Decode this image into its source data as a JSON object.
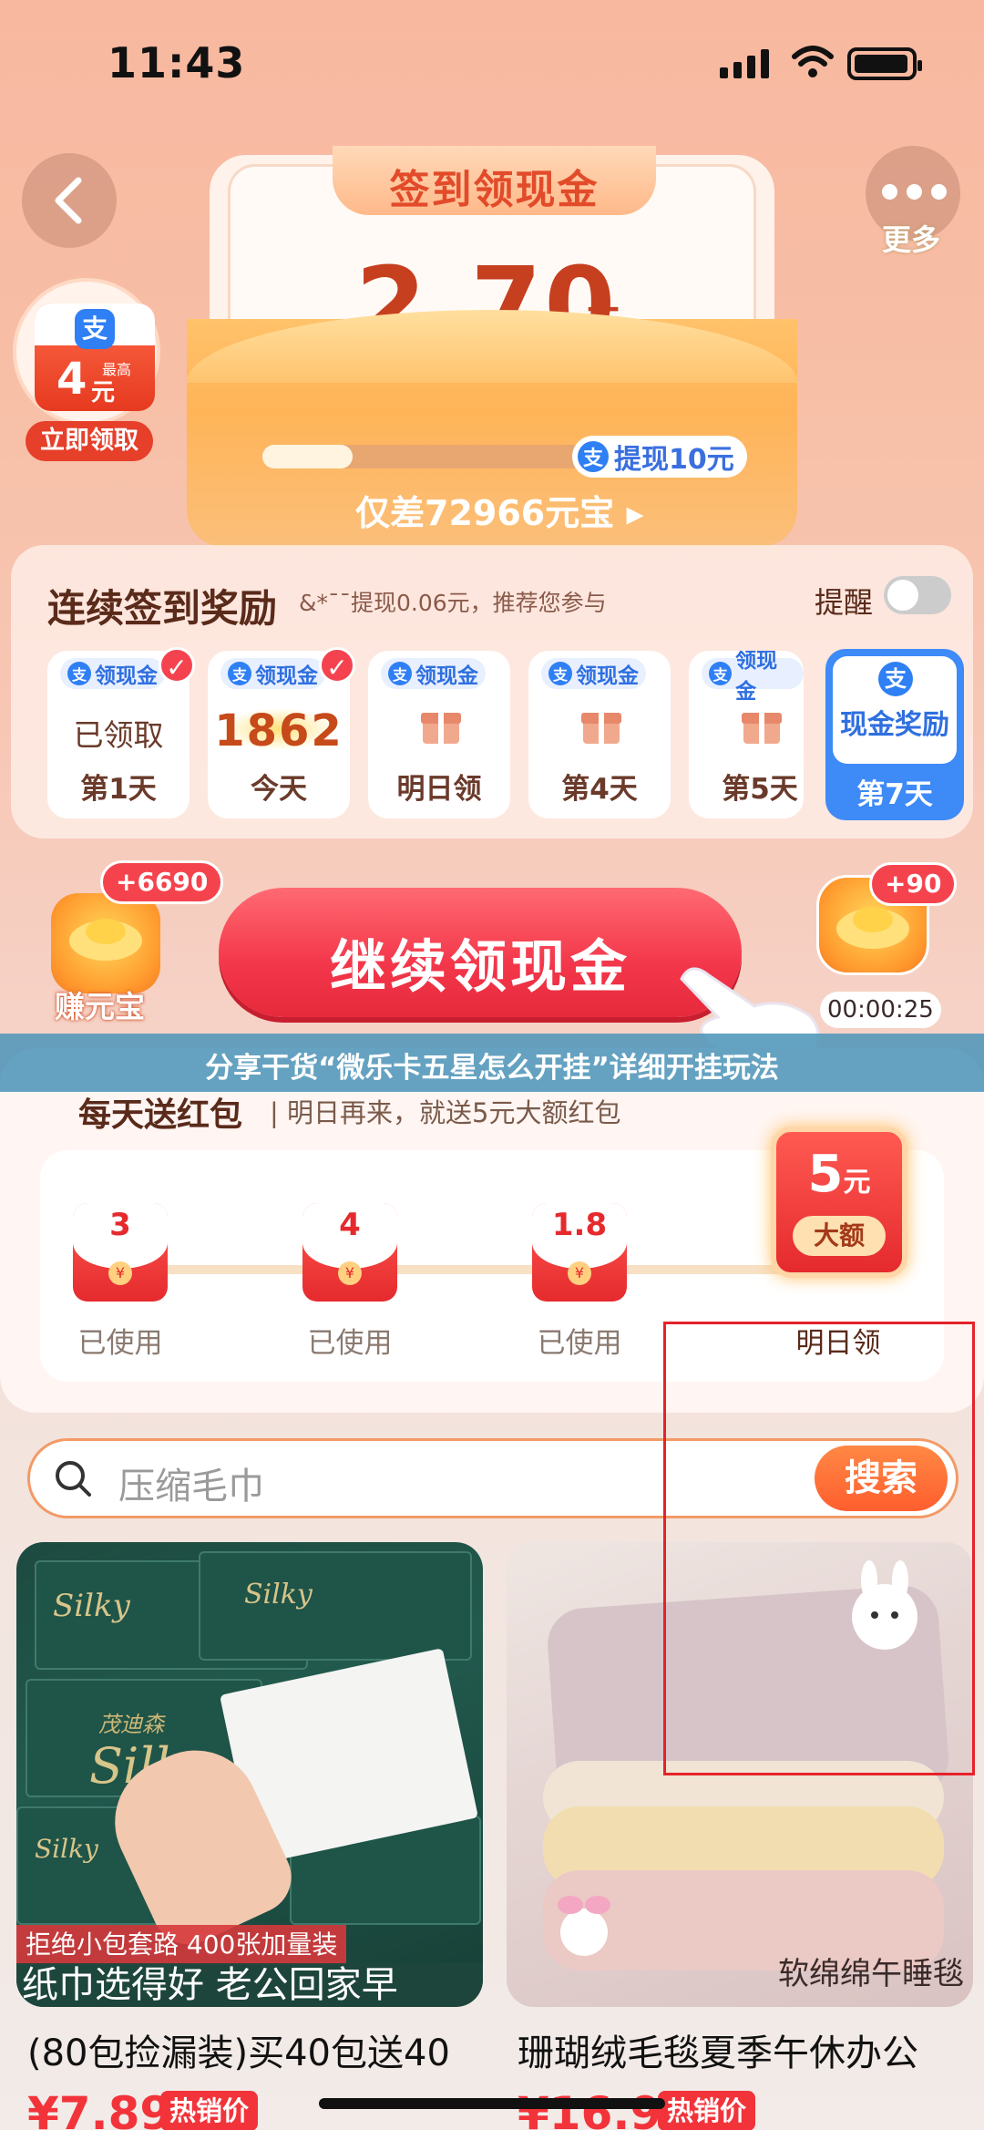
{
  "status_bar": {
    "time": "11:43"
  },
  "header": {
    "more_label": "更多"
  },
  "envelope": {
    "title": "签到领现金",
    "amount": "2.70",
    "amount_unit": "元",
    "progress_fraction": 0.19,
    "withdraw_label": "提现10元",
    "gap_text": "仅差72966元宝"
  },
  "left_badge": {
    "amount": "4",
    "unit": "元",
    "tag": "最高",
    "button": "立即领取"
  },
  "checkin": {
    "title": "连续签到奖励",
    "subtitle": "&*¯¯提现0.06元，推荐您参与",
    "remind_label": "提醒",
    "remind_on": false,
    "days": [
      {
        "tag": "领现金",
        "value": "已领取",
        "day": "第1天",
        "checked": true
      },
      {
        "tag": "领现金",
        "value": "1862",
        "day": "今天",
        "checked": true
      },
      {
        "tag": "领现金",
        "value": "",
        "day": "明日领",
        "checked": false
      },
      {
        "tag": "领现金",
        "value": "",
        "day": "第4天",
        "checked": false
      },
      {
        "tag": "领现金",
        "value": "",
        "day": "第5天",
        "checked": false
      }
    ],
    "day7": {
      "label": "现金奖励",
      "day": "第7天"
    }
  },
  "actions": {
    "left_badge": "+6690",
    "left_label": "赚元宝",
    "continue_label": "继续领现金",
    "right_badge": "+90",
    "right_timer": "00:00:25"
  },
  "banner": {
    "text": "分享干货“微乐卡五星怎么开挂”详细开挂玩法"
  },
  "red_packets": {
    "title": "每天送红包",
    "subtitle": "明日再来，就送5元大额红包",
    "items": [
      {
        "value": "3",
        "label": "已使用"
      },
      {
        "value": "4",
        "label": "已使用"
      },
      {
        "value": "1.8",
        "label": "已使用"
      }
    ],
    "big": {
      "value": "5",
      "unit": "元",
      "tag": "大额",
      "label": "明日领"
    }
  },
  "search": {
    "placeholder": "压缩毛巾",
    "button": "搜索"
  },
  "products": [
    {
      "brand": "茂迪森",
      "logo": "Silky",
      "tag": "拒绝小包套路 400张加量装",
      "band": "纸巾选得好 老公回家早",
      "title": "(80包捡漏装)买40包送40",
      "price": "¥7.89",
      "hot": "热销价"
    },
    {
      "caption": "软绵绵午睡毯",
      "title": "珊瑚绒毛毯夏季午休办公",
      "price": "¥16.9",
      "hot": "热销价"
    }
  ],
  "colors": {
    "accent": "#f3364a",
    "alipay": "#2f7ff5",
    "search_accent": "#ff6a36"
  }
}
